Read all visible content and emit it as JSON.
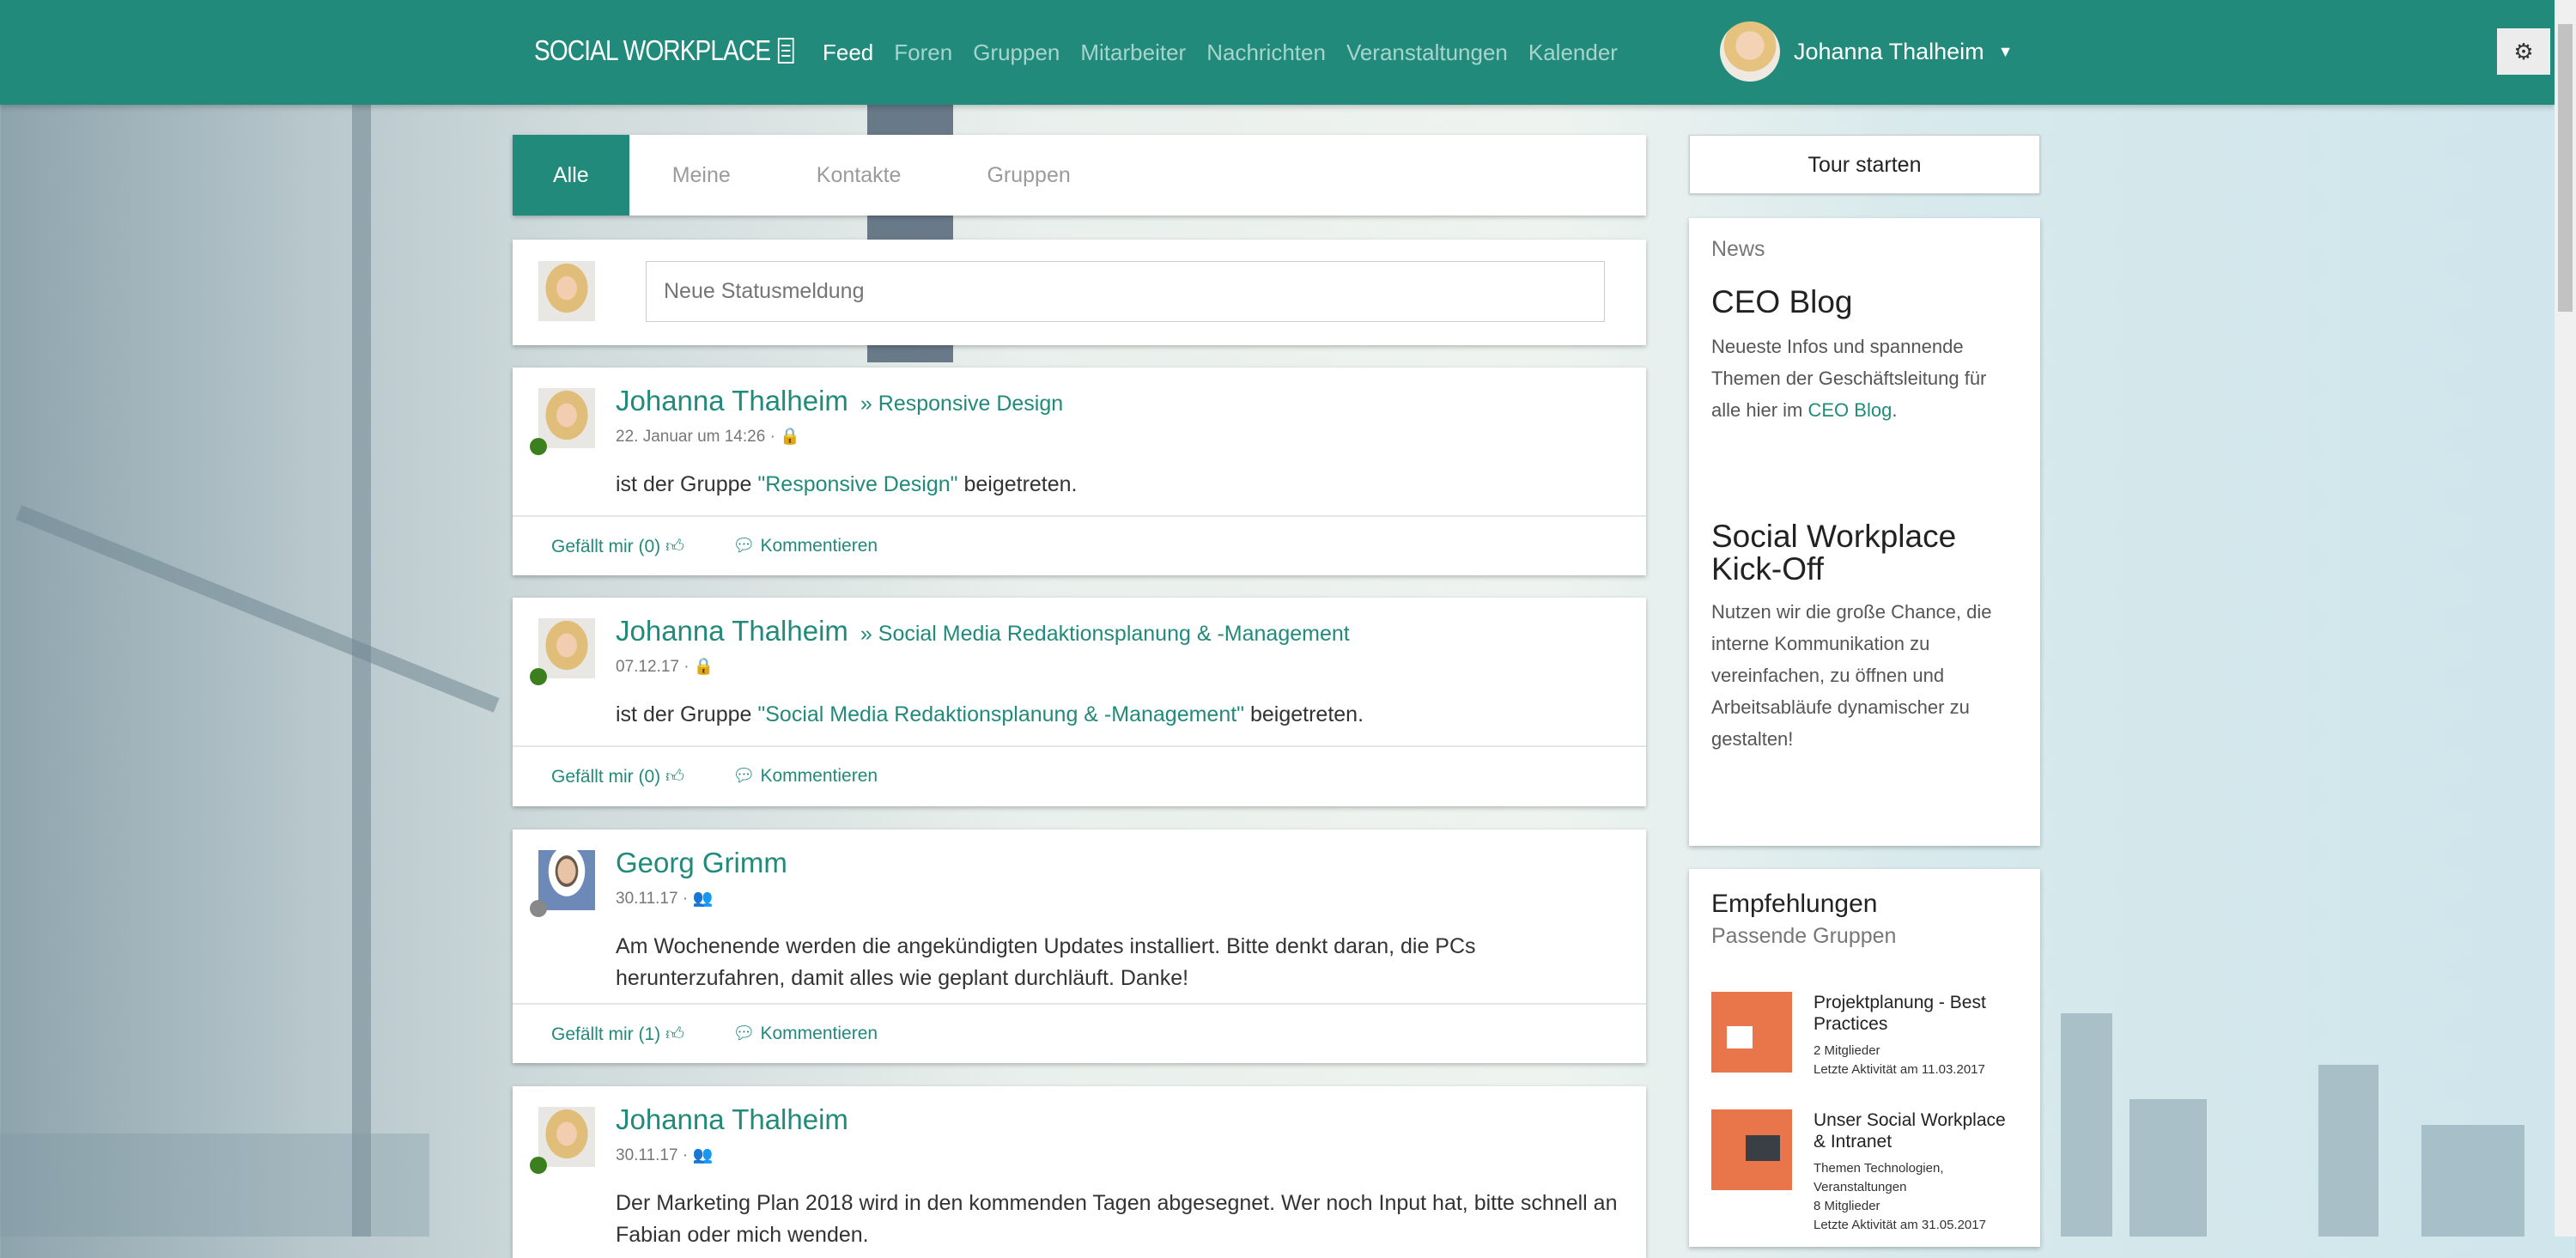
{
  "header": {
    "logo": "SOCIAL WORKPLACE",
    "nav": [
      "Feed",
      "Foren",
      "Gruppen",
      "Mitarbeiter",
      "Nachrichten",
      "Veranstaltungen",
      "Kalender"
    ],
    "user": "Johanna Thalheim"
  },
  "tabs": [
    "Alle",
    "Meine",
    "Kontakte",
    "Gruppen"
  ],
  "status": {
    "placeholder": "Neue Statusmeldung"
  },
  "posts": [
    {
      "author": "Johanna Thalheim",
      "group": "» Responsive Design",
      "meta": "22. Januar um 14:26  ·",
      "pre": "ist der Gruppe ",
      "link": "\"Responsive Design\"",
      "post": " beigetreten.",
      "like": "Gefällt mir (0)",
      "comment": "Kommentieren"
    },
    {
      "author": "Johanna Thalheim",
      "group": "» Social Media Redaktionsplanung & -Management",
      "meta": "07.12.17  ·",
      "pre": "ist der Gruppe ",
      "link": "\"Social Media Redaktionsplanung & -Management\"",
      "post": " beigetreten.",
      "like": "Gefällt mir (0)",
      "comment": "Kommentieren"
    },
    {
      "author": "Georg Grimm",
      "meta": "30.11.17  ·",
      "text": "Am Wochenende werden die angekündigten Updates installiert. Bitte denkt daran, die PCs herunterzufahren, damit alles wie geplant durchläuft. Danke!",
      "like": "Gefällt mir (1)",
      "comment": "Kommentieren"
    },
    {
      "author": "Johanna Thalheim",
      "meta": "30.11.17  ·",
      "text": "Der Marketing Plan 2018 wird in den kommenden Tagen abgesegnet. Wer noch Input hat, bitte schnell an Fabian oder mich wenden."
    }
  ],
  "sidebar": {
    "tour": "Tour starten",
    "news_label": "News",
    "news": [
      {
        "title": "CEO Blog",
        "text": "Neueste Infos und spannende Themen der Geschäftsleitung für alle hier im ",
        "link": "CEO Blog",
        "end": "."
      },
      {
        "title": "Social Workplace Kick-Off",
        "text": "Nutzen wir die große Chance, die interne Kommunikation zu vereinfachen, zu öffnen und Arbeitsabläufe dynamischer zu gestalten!"
      }
    ],
    "reco_title": "Empfehlungen",
    "reco_sub": "Passende Gruppen",
    "groups": [
      {
        "name": "Projektplanung - Best Practices",
        "meta1": "2 Mitglieder",
        "meta2": "Letzte Aktivität am 11.03.2017"
      },
      {
        "name": "Unser Social Workplace & Intranet",
        "meta0": "Themen Technologien, Veranstaltungen",
        "meta1": "8 Mitglieder",
        "meta2": "Letzte Aktivität am 31.05.2017"
      }
    ]
  },
  "colors": {
    "accent": "#228a7b",
    "online": "#3c7f1f"
  }
}
